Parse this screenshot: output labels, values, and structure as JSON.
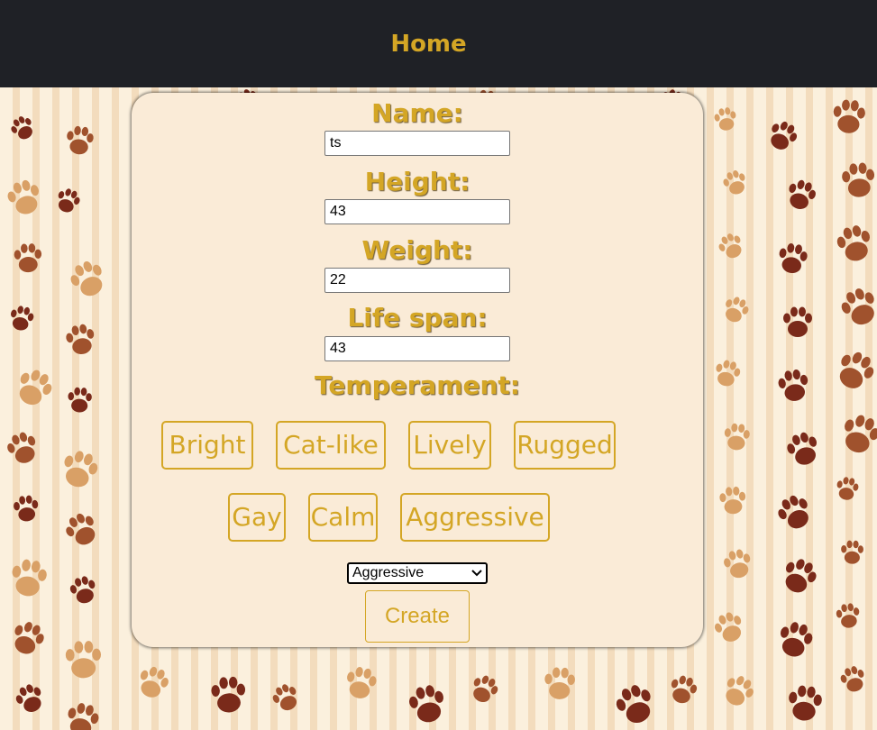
{
  "nav": {
    "home_label": "Home"
  },
  "form": {
    "name": {
      "label": "Name:",
      "value": "ts"
    },
    "height": {
      "label": "Height:",
      "value": "43"
    },
    "weight": {
      "label": "Weight:",
      "value": "22"
    },
    "life_span": {
      "label": "Life span:",
      "value": "43"
    },
    "temperament": {
      "label": "Temperament:",
      "chips": [
        "Bright",
        "Cat-like",
        "Lively",
        "Rugged",
        "Gay",
        "Calm",
        "Aggressive"
      ],
      "selected": "Aggressive"
    },
    "create_label": "Create"
  },
  "colors": {
    "accent": "#d4a625",
    "topbar": "#1f2126",
    "card": "#faebd7",
    "paw_dark": "#7a2a1a",
    "paw_mid": "#a0522d",
    "paw_light": "#d9a066"
  },
  "icons": {
    "background_pattern": "paw-print-icon",
    "dropdown": "chevron-down-icon"
  }
}
